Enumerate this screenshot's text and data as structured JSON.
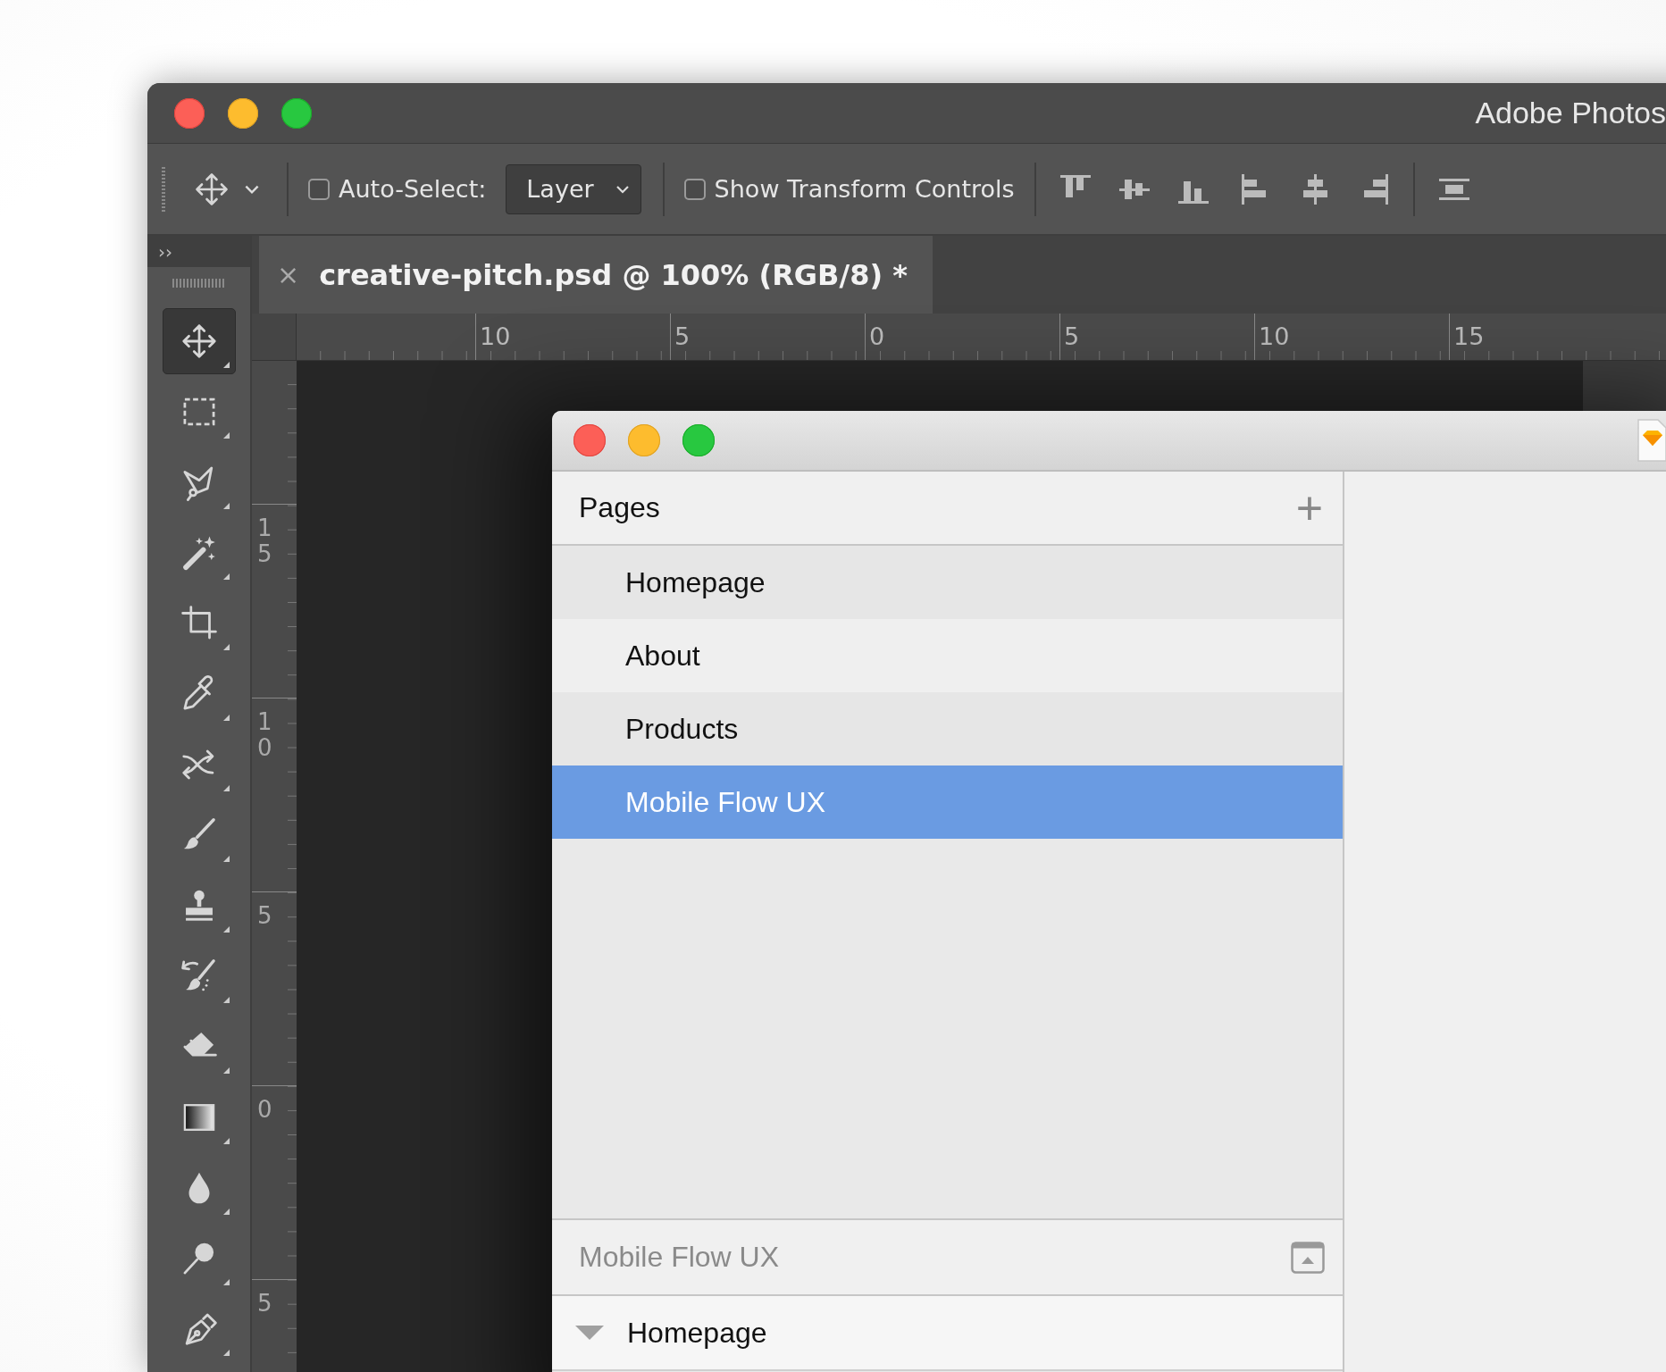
{
  "photoshop": {
    "title": "Adobe Photos",
    "options_bar": {
      "auto_select": {
        "label": "Auto-Select:",
        "checked": false
      },
      "target": {
        "value": "Layer"
      },
      "transform_controls": {
        "label": "Show Transform Controls",
        "checked": false
      }
    },
    "panel_toggle": "››",
    "tools": [
      {
        "selected": true
      },
      {
        "selected": false
      },
      {
        "selected": false
      },
      {
        "selected": false
      },
      {
        "selected": false
      },
      {
        "selected": false
      },
      {
        "selected": false
      },
      {
        "selected": false
      },
      {
        "selected": false
      },
      {
        "selected": false
      },
      {
        "selected": false
      },
      {
        "selected": false
      },
      {
        "selected": false
      },
      {
        "selected": false
      },
      {
        "selected": false
      }
    ],
    "document_tab": {
      "close": "×",
      "title": "creative-pitch.psd @ 100% (RGB/8) *"
    },
    "rulers": {
      "horizontal": [
        "10",
        "5",
        "0",
        "5",
        "10",
        "15"
      ],
      "vertical": [
        "15",
        "10",
        "5",
        "0",
        "5"
      ]
    }
  },
  "sketch": {
    "pages_header": "Pages",
    "add_page": "+",
    "pages": [
      {
        "name": "Homepage",
        "selected": false
      },
      {
        "name": "About",
        "selected": false
      },
      {
        "name": "Products",
        "selected": false
      },
      {
        "name": "Mobile Flow UX",
        "selected": true
      }
    ],
    "layers_header": "Mobile Flow UX",
    "layers": [
      {
        "name": "Homepage",
        "expanded": true
      }
    ]
  }
}
